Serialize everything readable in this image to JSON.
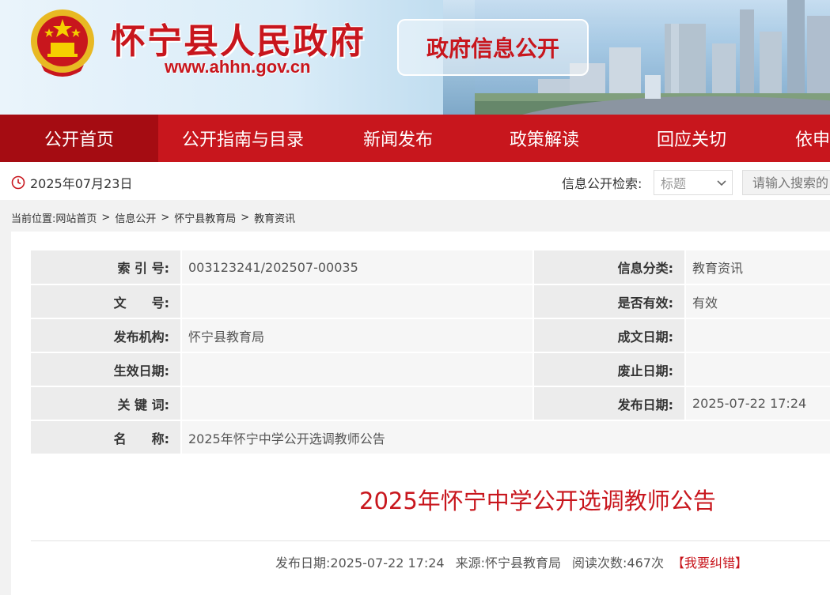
{
  "header": {
    "site_title": "怀宁县人民政府",
    "site_url": "www.ahhn.gov.cn",
    "section_tag": "政府信息公开",
    "emblem_icon": "national-emblem-icon",
    "brand_color": "#c8161d"
  },
  "nav": {
    "items": [
      {
        "label": "公开首页",
        "active": true
      },
      {
        "label": "公开指南与目录"
      },
      {
        "label": "新闻发布"
      },
      {
        "label": "政策解读"
      },
      {
        "label": "回应关切"
      },
      {
        "label": "依申"
      }
    ]
  },
  "toolbar": {
    "date": "2025年07月23日",
    "search_label": "信息公开检索:",
    "search_field_selected": "标题",
    "search_placeholder": "请输入搜索的"
  },
  "breadcrumb": {
    "prefix": "当前位置:",
    "items": [
      "网站首页",
      "信息公开",
      "怀宁县教育局",
      "教育资讯"
    ],
    "separator": ">"
  },
  "meta": {
    "index_label": "索 引 号:",
    "index_value": "003123241/202507-00035",
    "category_label": "信息分类:",
    "category_value": "教育资讯",
    "docno_label": "文　　号:",
    "docno_value": "",
    "valid_label": "是否有效:",
    "valid_value": "有效",
    "issuer_label": "发布机构:",
    "issuer_value": "怀宁县教育局",
    "created_label": "成文日期:",
    "created_value": "",
    "effective_label": "生效日期:",
    "effective_value": "",
    "expire_label": "废止日期:",
    "expire_value": "",
    "keywords_label": "关 键 词:",
    "keywords_value": "",
    "pubdate_label": "发布日期:",
    "pubdate_value": "2025-07-22 17:24",
    "name_label": "名　　称:",
    "name_value": "2025年怀宁中学公开选调教师公告"
  },
  "article": {
    "title": "2025年怀宁中学公开选调教师公告",
    "pub_label": "发布日期:",
    "pub_value": "2025-07-22 17:24",
    "source_label": "来源:",
    "source_value": "怀宁县教育局",
    "views_label": "阅读次数:",
    "views_value": "467次",
    "report_label": "【我要纠错】"
  }
}
